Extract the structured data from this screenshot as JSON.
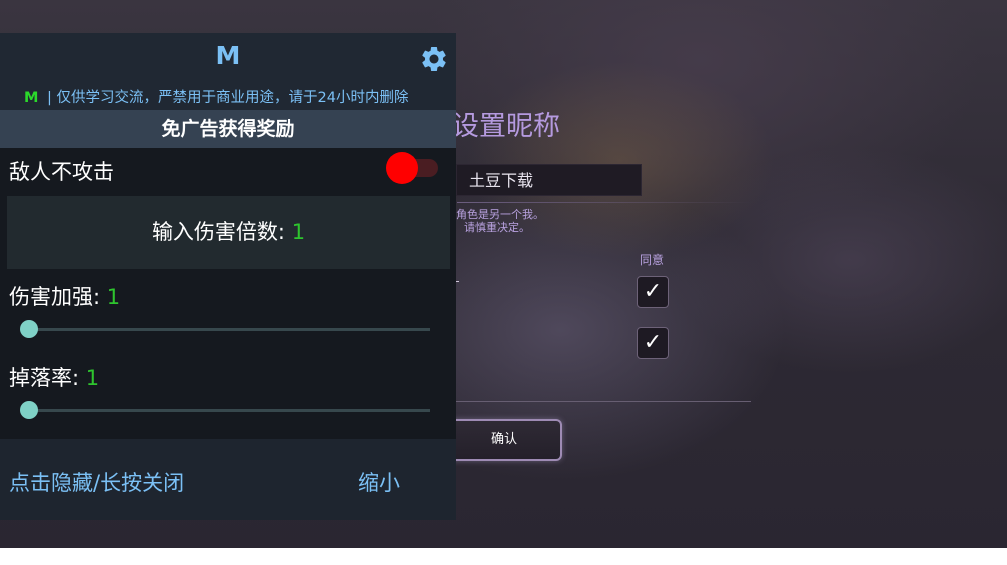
{
  "game": {
    "title": "设置昵称",
    "nickname_value": "土豆下载",
    "notice_line1": "角色是另一个我。",
    "notice_line2": "请慎重决定。",
    "agree_label": "同意",
    "confirm_label": "确认",
    "checkbox_1_checked": true,
    "checkbox_2_checked": true,
    "check_glyph": "✓"
  },
  "mod_menu": {
    "logo": "M",
    "disclaimer_brand": "M",
    "disclaimer_text": "| 仅供学习交流，严禁用于商业用途，请于24小时内删除",
    "reward_banner": "免广告获得奖励",
    "enemy_no_attack": {
      "label": "敌人不攻击",
      "enabled": true
    },
    "damage_multiplier": {
      "label": "输入伤害倍数: ",
      "value": "1"
    },
    "damage_boost": {
      "label": "伤害加强: ",
      "value": "1"
    },
    "drop_rate": {
      "label": "掉落率: ",
      "value": "1"
    },
    "hide_close_label": "点击隐藏/长按关闭",
    "shrink_label": "缩小"
  },
  "colors": {
    "accent_blue": "#7bc0f5",
    "value_green": "#2ec52e",
    "toggle_on": "#ff0000",
    "game_purple": "#b59adf"
  },
  "icons": {
    "settings": "gear-icon",
    "checkmark": "checkmark-icon"
  }
}
